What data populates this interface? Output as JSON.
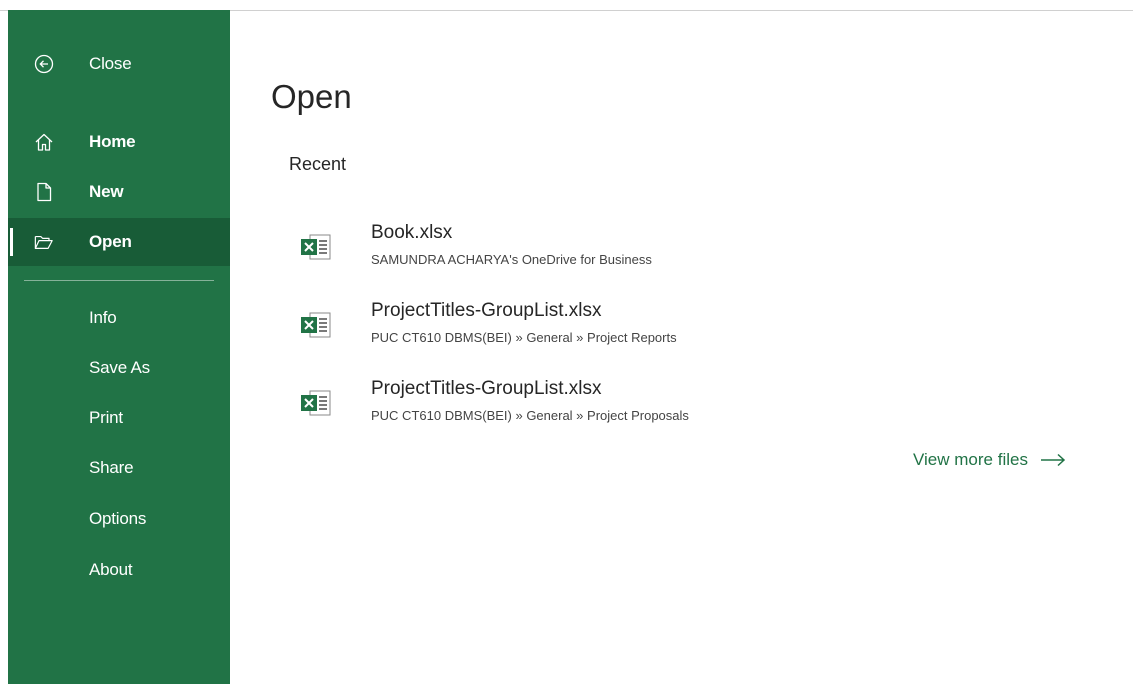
{
  "sidebar": {
    "items": [
      {
        "label": "Close",
        "icon": "back-arrow-circle-icon"
      },
      {
        "label": "Home",
        "icon": "home-icon"
      },
      {
        "label": "New",
        "icon": "new-document-icon"
      },
      {
        "label": "Open",
        "icon": "open-folder-icon"
      },
      {
        "label": "Info"
      },
      {
        "label": "Save As"
      },
      {
        "label": "Print"
      },
      {
        "label": "Share"
      },
      {
        "label": "Options"
      },
      {
        "label": "About"
      }
    ],
    "active": "Open"
  },
  "main": {
    "title": "Open",
    "recent_label": "Recent",
    "files": [
      {
        "name": "Book.xlsx",
        "path": "SAMUNDRA ACHARYA's OneDrive for Business",
        "icon": "excel-file-icon"
      },
      {
        "name": "ProjectTitles-GroupList.xlsx",
        "path": "PUC CT610 DBMS(BEI) » General » Project Reports",
        "icon": "excel-file-icon"
      },
      {
        "name": "ProjectTitles-GroupList.xlsx",
        "path": "PUC CT610 DBMS(BEI) » General » Project Proposals",
        "icon": "excel-file-icon"
      }
    ],
    "view_more_label": "View more files"
  },
  "colors": {
    "sidebar_bg": "#217346",
    "sidebar_active": "#185c37",
    "accent": "#217346",
    "text": "#262626"
  }
}
